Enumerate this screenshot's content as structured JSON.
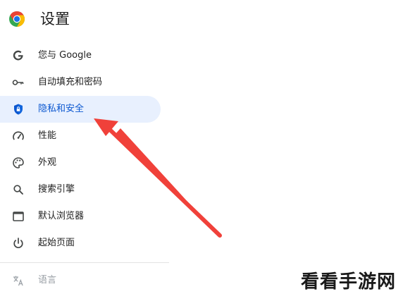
{
  "header": {
    "title": "设置",
    "logo_icon": "chrome-logo-icon"
  },
  "nav": {
    "items": [
      {
        "label": "您与 Google",
        "icon": "google-g-icon"
      },
      {
        "label": "自动填充和密码",
        "icon": "key-icon"
      },
      {
        "label": "隐私和安全",
        "icon": "shield-icon",
        "active": true
      },
      {
        "label": "性能",
        "icon": "speedometer-icon"
      },
      {
        "label": "外观",
        "icon": "palette-icon"
      },
      {
        "label": "搜索引擎",
        "icon": "search-icon"
      },
      {
        "label": "默认浏览器",
        "icon": "browser-window-icon"
      },
      {
        "label": "起始页面",
        "icon": "power-icon"
      }
    ],
    "language": {
      "label": "语言",
      "icon": "translate-icon"
    }
  },
  "watermark": "看看手游网",
  "colors": {
    "active_bg": "#e8f0fe",
    "active_text": "#0b57d0",
    "arrow": "#f0413a"
  }
}
